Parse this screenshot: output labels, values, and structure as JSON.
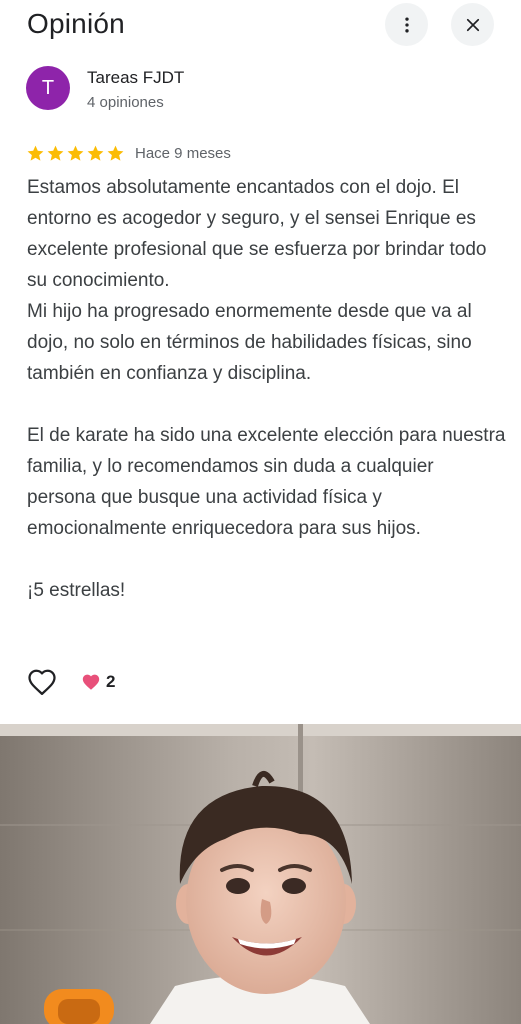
{
  "header": {
    "title": "Opinión",
    "more_icon": "more-vert-icon",
    "close_icon": "close-icon"
  },
  "user": {
    "avatar_letter": "T",
    "avatar_color": "#8e24aa",
    "name": "Tareas FJDT",
    "reviews": "4 opiniones"
  },
  "review": {
    "rating": 5,
    "star_color": "#fbbc04",
    "time_ago": "Hace 9 meses",
    "paragraphs": [
      "Estamos absolutamente encantados con el dojo. El entorno es acogedor y seguro, y el sensei Enrique es excelente profesional que se esfuerza por brindar todo su conocimiento.",
      "Mi hijo ha progresado enormemente desde que va al dojo, no solo en términos de habilidades físicas, sino también en confianza y disciplina.",
      "El de karate ha sido una excelente elección para nuestra familia, y lo recomendamos sin duda a cualquier persona que busque una actividad física y emocionalmente enriquecedora para sus hijos.",
      "¡5 estrellas!"
    ]
  },
  "actions": {
    "like_icon": "heart-outline-icon",
    "reaction_icon": "heart-filled-icon",
    "reaction_color": "#e8507a",
    "like_count": "2"
  },
  "photo": {
    "subject": "review-photo"
  }
}
